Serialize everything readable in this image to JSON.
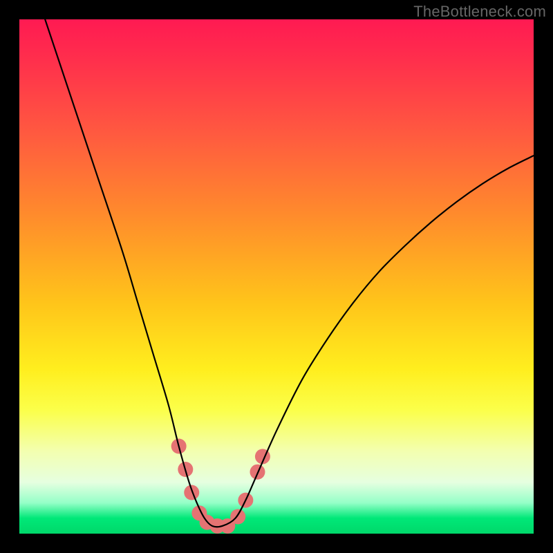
{
  "watermark": "TheBottleneck.com",
  "chart_data": {
    "type": "line",
    "title": "",
    "xlabel": "",
    "ylabel": "",
    "xlim": [
      0,
      100
    ],
    "ylim": [
      0,
      100
    ],
    "grid": false,
    "legend": false,
    "series": [
      {
        "name": "bottleneck-curve",
        "color": "#000000",
        "x": [
          5,
          10,
          15,
          20,
          23,
          26,
          29,
          31,
          33,
          34.5,
          36,
          37.5,
          39.5,
          42,
          44,
          46,
          50,
          55,
          60,
          65,
          70,
          75,
          80,
          85,
          90,
          95,
          100
        ],
        "y": [
          100,
          85,
          70,
          55,
          45,
          35,
          25,
          17,
          10,
          6,
          3,
          1.5,
          1.5,
          3,
          6.5,
          11,
          20,
          30,
          38,
          45,
          51,
          56,
          60.5,
          64.5,
          68,
          71,
          73.5
        ]
      }
    ],
    "highlight_markers": {
      "name": "salmon-dots",
      "color": "#e57373",
      "radius_px": 11,
      "points": [
        {
          "x": 31,
          "y": 17
        },
        {
          "x": 32.3,
          "y": 12.5
        },
        {
          "x": 33.5,
          "y": 8
        },
        {
          "x": 35,
          "y": 4
        },
        {
          "x": 36.5,
          "y": 2.2
        },
        {
          "x": 38.5,
          "y": 1.5
        },
        {
          "x": 40.5,
          "y": 1.5
        },
        {
          "x": 42.5,
          "y": 3.3
        },
        {
          "x": 44,
          "y": 6.5
        },
        {
          "x": 46.3,
          "y": 12
        },
        {
          "x": 47.3,
          "y": 15
        }
      ]
    },
    "background_gradient": {
      "direction": "vertical",
      "stops": [
        {
          "pos": 0,
          "color": "#ff1a52"
        },
        {
          "pos": 0.55,
          "color": "#ffee1e"
        },
        {
          "pos": 1.0,
          "color": "#00d86a"
        }
      ]
    }
  }
}
